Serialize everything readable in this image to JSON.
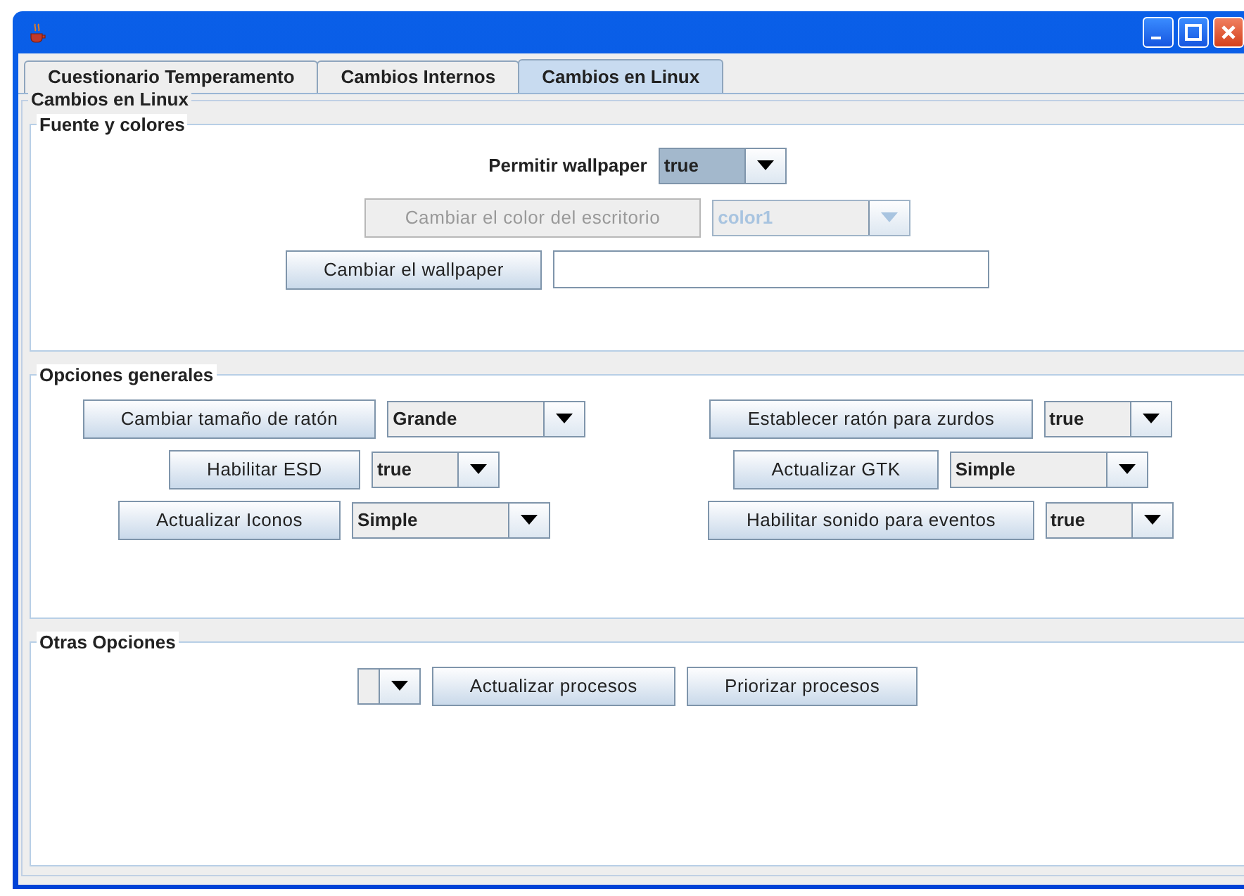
{
  "tabs": [
    {
      "label": "Cuestionario Temperamento",
      "selected": false
    },
    {
      "label": "Cambios Internos",
      "selected": false
    },
    {
      "label": "Cambios en Linux",
      "selected": true
    }
  ],
  "panel_title": "Cambios en Linux",
  "groups": [
    {
      "title": "Fuente y colores",
      "rows": [
        [
          [
            {
              "kind": "label",
              "text": "Permitir wallpaper"
            },
            {
              "kind": "combo",
              "value": "true",
              "disabled": false,
              "highlighted": true
            }
          ]
        ],
        [
          [
            {
              "kind": "button",
              "label": "Cambiar el color del escritorio",
              "disabled": true
            },
            {
              "kind": "combo",
              "value": "color1",
              "disabled": true,
              "highlighted": false
            }
          ]
        ],
        [
          [
            {
              "kind": "button",
              "label": "Cambiar el wallpaper",
              "disabled": false
            },
            {
              "kind": "text_field"
            }
          ]
        ]
      ]
    },
    {
      "title": "Opciones generales",
      "rows": [
        [
          [
            {
              "kind": "button",
              "label": "Cambiar tamaño de ratón",
              "disabled": false
            },
            {
              "kind": "combo",
              "value": "Grande",
              "disabled": false,
              "highlighted": false
            }
          ],
          [
            {
              "kind": "button",
              "label": "Establecer ratón para zurdos",
              "disabled": false
            },
            {
              "kind": "combo",
              "value": "true",
              "disabled": false,
              "highlighted": false
            }
          ]
        ],
        [
          [
            {
              "kind": "button",
              "label": "Habilitar ESD",
              "disabled": false
            },
            {
              "kind": "combo",
              "value": "true",
              "disabled": false,
              "highlighted": false
            }
          ],
          [
            {
              "kind": "button",
              "label": "Actualizar GTK",
              "disabled": false
            },
            {
              "kind": "combo",
              "value": "Simple",
              "disabled": false,
              "highlighted": false
            }
          ]
        ],
        [
          [
            {
              "kind": "button",
              "label": "Actualizar Iconos",
              "disabled": false
            },
            {
              "kind": "combo",
              "value": "Simple",
              "disabled": false,
              "highlighted": false
            }
          ],
          [
            {
              "kind": "button",
              "label": "Habilitar sonido para eventos",
              "disabled": false
            },
            {
              "kind": "combo",
              "value": "true",
              "disabled": false,
              "highlighted": false
            }
          ]
        ]
      ]
    },
    {
      "title": "Otras Opciones",
      "rows": [
        [
          [
            {
              "kind": "combo",
              "disabled": false,
              "highlighted": false
            },
            {
              "kind": "button",
              "label": "Actualizar procesos",
              "disabled": false
            },
            {
              "kind": "button",
              "label": "Priorizar procesos",
              "disabled": false
            }
          ]
        ]
      ]
    }
  ]
}
